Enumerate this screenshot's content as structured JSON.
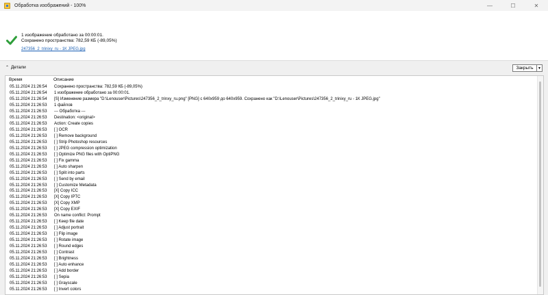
{
  "window": {
    "title": "Обработка изображений - 100%",
    "controls": {
      "minimize": "—",
      "maximize": "☐",
      "close": "✕"
    }
  },
  "summary": {
    "line1": "1 изображение обработано за 00:00:01.",
    "line2": "Сохранено пространства: 782,59 КБ (-89,05%)",
    "file_link": "247356_2_trinixy_ru - 1К JPEG.jpg",
    "status_icon": "checkmark-icon",
    "status_color": "#2e9e3a"
  },
  "details": {
    "toggle_label": "Детали",
    "toggle_icon": "chevron-up-icon",
    "close_label": "Закрыть",
    "close_dropdown_icon": "caret-down-icon"
  },
  "log": {
    "columns": [
      "Время",
      "Описание"
    ],
    "rows": [
      [
        "05.11.2024 21:26:54",
        "Сохранено пространства: 782,59 КБ (-89,05%)"
      ],
      [
        "05.11.2024 21:26:54",
        "1 изображение обработано за 00:00:01."
      ],
      [
        "05.11.2024 21:26:54",
        "[S] Изменение размера \"D:\\Lenouser\\Pictures\\247356_2_trinxy_ru.png\" [PNG] с 640x959 до 640x959. Сохранено как \"D:\\Lenouser\\Pictures\\247356_2_trinixy_ru - 1К JPEG.jpg\""
      ],
      [
        "05.11.2024 21:26:53",
        "1 файлов"
      ],
      [
        "05.11.2024 21:26:53",
        "--- Обработка ---"
      ],
      [
        "05.11.2024 21:26:53",
        "Destination: <original>"
      ],
      [
        "05.11.2024 21:26:53",
        "Action: Create copies"
      ],
      [
        "05.11.2024 21:26:53",
        "[ ] OCR"
      ],
      [
        "05.11.2024 21:26:53",
        "[ ] Remove background"
      ],
      [
        "05.11.2024 21:26:53",
        "[ ] Strip Photoshop resources"
      ],
      [
        "05.11.2024 21:26:53",
        "[ ] JPEG compression optimization"
      ],
      [
        "05.11.2024 21:26:53",
        "[ ] Optimize PNG files with OptiPNG"
      ],
      [
        "05.11.2024 21:26:53",
        "[ ] Fix gamma"
      ],
      [
        "05.11.2024 21:26:53",
        "[ ] Auto sharpen"
      ],
      [
        "05.11.2024 21:26:53",
        "[ ] Split into parts"
      ],
      [
        "05.11.2024 21:26:53",
        "[ ] Send by email"
      ],
      [
        "05.11.2024 21:26:53",
        "[ ] Customize Metadata"
      ],
      [
        "05.11.2024 21:26:53",
        "[X] Copy ICC"
      ],
      [
        "05.11.2024 21:26:53",
        "[X] Copy IPTC"
      ],
      [
        "05.11.2024 21:26:53",
        "[X] Copy XMP"
      ],
      [
        "05.11.2024 21:26:53",
        "[X] Copy EXIF"
      ],
      [
        "05.11.2024 21:26:53",
        "On name conflict: Prompt"
      ],
      [
        "05.11.2024 21:26:53",
        "[ ] Keep file date"
      ],
      [
        "05.11.2024 21:26:53",
        "[ ] Adjust portrait"
      ],
      [
        "05.11.2024 21:26:53",
        "[ ] Flip image"
      ],
      [
        "05.11.2024 21:26:53",
        "[ ] Rotate image"
      ],
      [
        "05.11.2024 21:26:53",
        "[ ] Round edges"
      ],
      [
        "05.11.2024 21:26:53",
        "[ ] Contrast"
      ],
      [
        "05.11.2024 21:26:53",
        "[ ] Brightness"
      ],
      [
        "05.11.2024 21:26:53",
        "[ ] Auto enhance"
      ],
      [
        "05.11.2024 21:26:53",
        "[ ] Add border"
      ],
      [
        "05.11.2024 21:26:53",
        "[ ] Sepia"
      ],
      [
        "05.11.2024 21:26:53",
        "[ ] Grayscale"
      ],
      [
        "05.11.2024 21:26:53",
        "[ ] Invert colors"
      ]
    ]
  }
}
